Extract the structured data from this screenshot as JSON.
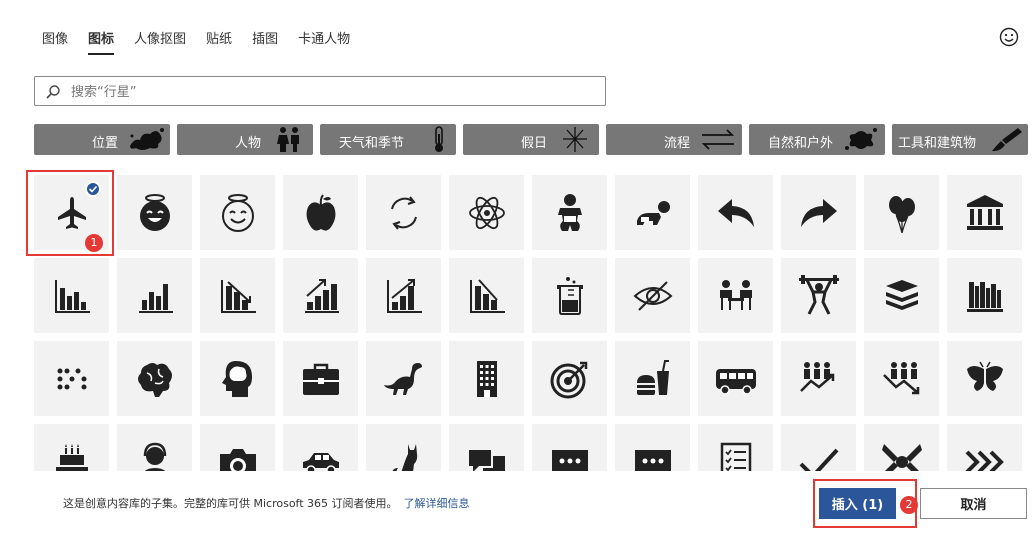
{
  "tabs": [
    {
      "label": "图像"
    },
    {
      "label": "图标"
    },
    {
      "label": "人像抠图"
    },
    {
      "label": "贴纸"
    },
    {
      "label": "插图"
    },
    {
      "label": "卡通人物"
    }
  ],
  "active_tab": "图标",
  "search": {
    "placeholder": "搜索“行星”"
  },
  "categories": [
    {
      "label": "位置",
      "icon": "map-splat-icon"
    },
    {
      "label": "人物",
      "icon": "people-icon"
    },
    {
      "label": "天气和季节",
      "icon": "thermometer-icon"
    },
    {
      "label": "假日",
      "icon": "fireworks-icon"
    },
    {
      "label": "流程",
      "icon": "arrows-exchange-icon"
    },
    {
      "label": "自然和户外",
      "icon": "splat-icon"
    },
    {
      "label": "工具和建筑物",
      "icon": "brush-icon"
    }
  ],
  "icons": [
    "airplane-icon",
    "smiley-halo-filled-icon",
    "smiley-halo-outline-icon",
    "apple-icon",
    "refresh-cycle-icon",
    "atom-icon",
    "baby-icon",
    "crawling-baby-icon",
    "reply-arrow-icon",
    "forward-arrow-icon",
    "balloons-icon",
    "bank-icon",
    "bar-chart-icon",
    "bar-chart-2-icon",
    "bar-chart-down-icon",
    "bar-chart-up-icon",
    "bar-chart-up-2-icon",
    "bar-chart-down-2-icon",
    "beaker-icon",
    "eye-hidden-icon",
    "meeting-icon",
    "weightlifting-icon",
    "books-icon",
    "bookshelf-icon",
    "braille-icon",
    "brain-icon",
    "head-brain-icon",
    "briefcase-icon",
    "dinosaur-icon",
    "building-icon",
    "target-icon",
    "fast-food-icon",
    "bus-icon",
    "people-growth-icon",
    "people-decline-icon",
    "butterfly-icon",
    "birthday-cake-icon",
    "call-center-icon",
    "camera-icon",
    "car-icon",
    "cat-icon",
    "chat-bubbles-icon",
    "chat-dots-icon",
    "comment-dots-icon",
    "checklist-icon",
    "checkmark-icon",
    "teamwork-hands-icon",
    "chevrons-right-icon"
  ],
  "selected_icon": "airplane-icon",
  "markers": {
    "first": "1",
    "second": "2"
  },
  "footer": {
    "note": "这是创意内容库的子集。完整的库可供 Microsoft 365 订阅者使用。",
    "link": "了解详细信息"
  },
  "buttons": {
    "insert": "插入 (1)",
    "cancel": "取消"
  },
  "colors": {
    "accent": "#2b579a",
    "highlight": "#e53935",
    "category_bg": "#777777",
    "tile_bg": "#f2f2f2"
  }
}
